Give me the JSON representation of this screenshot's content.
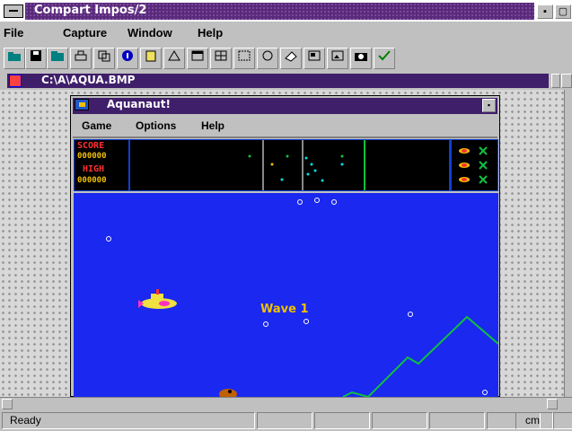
{
  "app": {
    "title": "Compart Impos/2",
    "min_label": "▪",
    "max_label": "▢"
  },
  "menu": [
    {
      "label": "File"
    },
    {
      "label": "Capture"
    },
    {
      "label": "Window"
    },
    {
      "label": "Help"
    }
  ],
  "toolbar": {
    "buttons": [
      "open-icon",
      "save-icon",
      "folder-icon",
      "print-icon",
      "copy-icon",
      "info-icon",
      "clipboard-icon",
      "paste-icon",
      "window-icon",
      "grid-icon",
      "region-icon",
      "circle-icon",
      "eraser-icon",
      "frame-icon",
      "desktop-icon",
      "camera-icon",
      "check-icon"
    ]
  },
  "document": {
    "title": "C:\\A\\AQUA.BMP"
  },
  "aquanaut": {
    "title": "Aquanaut!",
    "close_label": "▪",
    "menu": [
      {
        "label": "Game"
      },
      {
        "label": "Options"
      },
      {
        "label": "Help"
      }
    ],
    "hud": {
      "score_label": "SCORE",
      "score_value": "000000",
      "high_label": "HIGH",
      "high_value": "000000"
    },
    "wave_label": "Wave 1"
  },
  "status": {
    "text": "Ready",
    "mode": "cm"
  },
  "colors": {
    "game_bg": "#1a28f0",
    "title_purple": "#3f1e6a",
    "hud_yellow": "#f0c000",
    "hud_red": "#ff3030",
    "seabed_green": "#10c040"
  }
}
